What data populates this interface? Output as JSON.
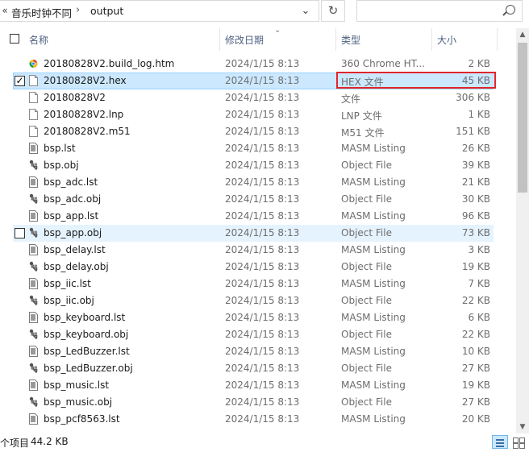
{
  "address": {
    "crumbs": [
      "音乐时钟不同",
      "output"
    ],
    "separator": "›",
    "overflow_glyph": "«",
    "dropdown_glyph": "⌄",
    "refresh_glyph": "↻"
  },
  "columns": {
    "name": "名称",
    "date": "修改日期",
    "type": "类型",
    "size": "大小"
  },
  "files": [
    {
      "name": "20180828V2.build_log.htm",
      "date": "2024/1/15 8:13",
      "type": "360 Chrome HT...",
      "size": "2 KB",
      "icon": "chrome-html-icon"
    },
    {
      "name": "20180828V2.hex",
      "date": "2024/1/15 8:13",
      "type": "HEX 文件",
      "size": "45 KB",
      "icon": "blank-file-icon",
      "selected": true,
      "checked": true
    },
    {
      "name": "20180828V2",
      "date": "2024/1/15 8:13",
      "type": "文件",
      "size": "306 KB",
      "icon": "blank-file-icon"
    },
    {
      "name": "20180828V2.lnp",
      "date": "2024/1/15 8:13",
      "type": "LNP 文件",
      "size": "1 KB",
      "icon": "blank-file-icon"
    },
    {
      "name": "20180828V2.m51",
      "date": "2024/1/15 8:13",
      "type": "M51 文件",
      "size": "151 KB",
      "icon": "blank-file-icon"
    },
    {
      "name": "bsp.lst",
      "date": "2024/1/15 8:13",
      "type": "MASM Listing",
      "size": "26 KB",
      "icon": "listing-file-icon"
    },
    {
      "name": "bsp.obj",
      "date": "2024/1/15 8:13",
      "type": "Object File",
      "size": "39 KB",
      "icon": "object-file-icon"
    },
    {
      "name": "bsp_adc.lst",
      "date": "2024/1/15 8:13",
      "type": "MASM Listing",
      "size": "21 KB",
      "icon": "listing-file-icon"
    },
    {
      "name": "bsp_adc.obj",
      "date": "2024/1/15 8:13",
      "type": "Object File",
      "size": "30 KB",
      "icon": "object-file-icon"
    },
    {
      "name": "bsp_app.lst",
      "date": "2024/1/15 8:13",
      "type": "MASM Listing",
      "size": "96 KB",
      "icon": "listing-file-icon"
    },
    {
      "name": "bsp_app.obj",
      "date": "2024/1/15 8:13",
      "type": "Object File",
      "size": "73 KB",
      "icon": "object-file-icon",
      "hover": true
    },
    {
      "name": "bsp_delay.lst",
      "date": "2024/1/15 8:13",
      "type": "MASM Listing",
      "size": "3 KB",
      "icon": "listing-file-icon"
    },
    {
      "name": "bsp_delay.obj",
      "date": "2024/1/15 8:13",
      "type": "Object File",
      "size": "19 KB",
      "icon": "object-file-icon"
    },
    {
      "name": "bsp_iic.lst",
      "date": "2024/1/15 8:13",
      "type": "MASM Listing",
      "size": "7 KB",
      "icon": "listing-file-icon"
    },
    {
      "name": "bsp_iic.obj",
      "date": "2024/1/15 8:13",
      "type": "Object File",
      "size": "22 KB",
      "icon": "object-file-icon"
    },
    {
      "name": "bsp_keyboard.lst",
      "date": "2024/1/15 8:13",
      "type": "MASM Listing",
      "size": "6 KB",
      "icon": "listing-file-icon"
    },
    {
      "name": "bsp_keyboard.obj",
      "date": "2024/1/15 8:13",
      "type": "Object File",
      "size": "22 KB",
      "icon": "object-file-icon"
    },
    {
      "name": "bsp_LedBuzzer.lst",
      "date": "2024/1/15 8:13",
      "type": "MASM Listing",
      "size": "10 KB",
      "icon": "listing-file-icon"
    },
    {
      "name": "bsp_LedBuzzer.obj",
      "date": "2024/1/15 8:13",
      "type": "Object File",
      "size": "27 KB",
      "icon": "object-file-icon"
    },
    {
      "name": "bsp_music.lst",
      "date": "2024/1/15 8:13",
      "type": "MASM Listing",
      "size": "19 KB",
      "icon": "listing-file-icon"
    },
    {
      "name": "bsp_music.obj",
      "date": "2024/1/15 8:13",
      "type": "Object File",
      "size": "27 KB",
      "icon": "object-file-icon"
    },
    {
      "name": "bsp_pcf8563.lst",
      "date": "2024/1/15 8:13",
      "type": "MASM Listing",
      "size": "20 KB",
      "icon": "listing-file-icon"
    }
  ],
  "status": {
    "count": "个项目",
    "selected_size": "44.2 KB"
  },
  "colors": {
    "selection_bg": "#cce8ff",
    "selection_border": "#99d1ff",
    "hover_bg": "#e5f3ff",
    "highlight_outline": "#e0262b",
    "header_text": "#4d6082"
  }
}
